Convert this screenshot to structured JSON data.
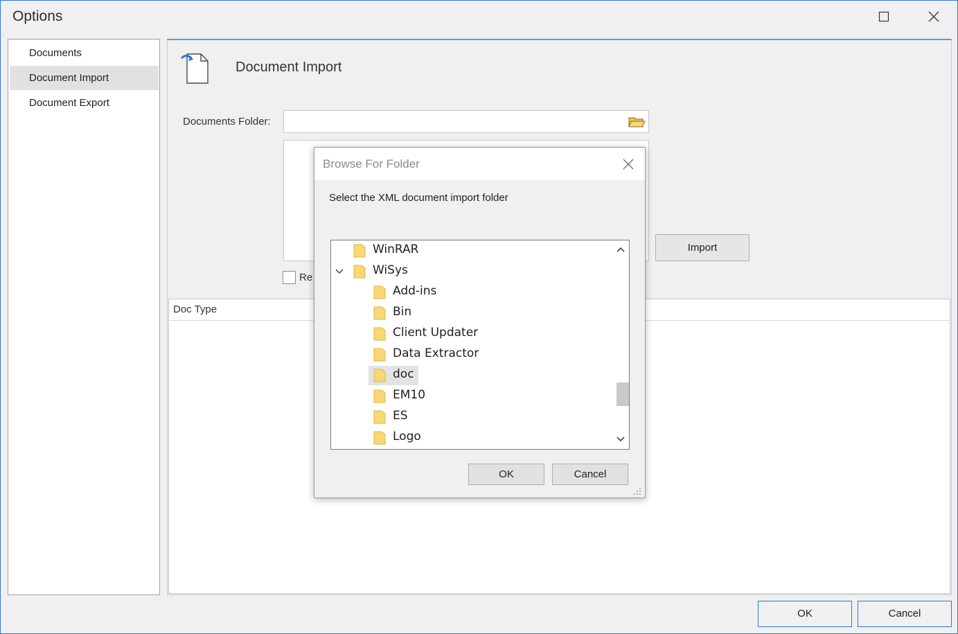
{
  "window": {
    "title": "Options",
    "maximize_icon": "maximize-icon",
    "close_icon": "close-icon"
  },
  "sidebar": {
    "items": [
      {
        "label": "Documents",
        "selected": false
      },
      {
        "label": "Document Import",
        "selected": true
      },
      {
        "label": "Document Export",
        "selected": false
      }
    ]
  },
  "main": {
    "title": "Document Import",
    "folder_label": "Documents Folder:",
    "folder_value": "",
    "import_label": "Import",
    "remove_label": "Re",
    "grid_header": "Doc Type"
  },
  "footer": {
    "ok_label": "OK",
    "cancel_label": "Cancel"
  },
  "dialog": {
    "title": "Browse For Folder",
    "instruction": "Select the XML document import folder",
    "tree": [
      {
        "label": "WinRAR",
        "level": 0,
        "expanded": false,
        "selected": false
      },
      {
        "label": "WiSys",
        "level": 0,
        "expanded": true,
        "selected": false
      },
      {
        "label": "Add-ins",
        "level": 1,
        "expanded": false,
        "selected": false
      },
      {
        "label": "Bin",
        "level": 1,
        "expanded": false,
        "selected": false
      },
      {
        "label": "Client Updater",
        "level": 1,
        "expanded": false,
        "selected": false
      },
      {
        "label": "Data Extractor",
        "level": 1,
        "expanded": false,
        "selected": false
      },
      {
        "label": "doc",
        "level": 1,
        "expanded": false,
        "selected": true
      },
      {
        "label": "EM10",
        "level": 1,
        "expanded": false,
        "selected": false
      },
      {
        "label": "ES",
        "level": 1,
        "expanded": false,
        "selected": false
      },
      {
        "label": "Logo",
        "level": 1,
        "expanded": false,
        "selected": false
      }
    ],
    "ok_label": "OK",
    "cancel_label": "Cancel"
  },
  "colors": {
    "accent": "#2b79d6",
    "folder": "#f8d775",
    "selection": "#e1e1e1"
  }
}
